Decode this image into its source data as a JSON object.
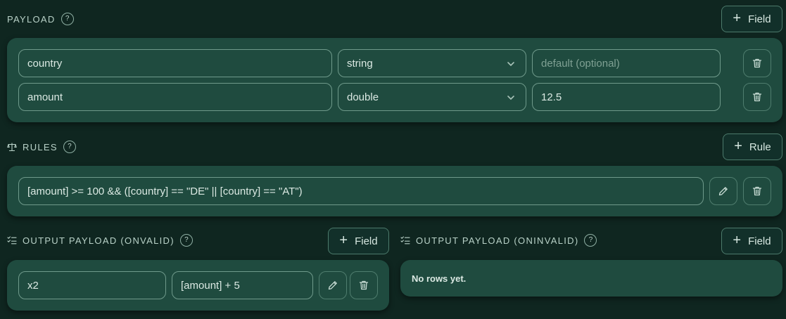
{
  "payload": {
    "title": "PAYLOAD",
    "help": "?",
    "add_label": "Field",
    "rows": [
      {
        "name": "country",
        "type": "string",
        "default_value": "",
        "default_placeholder": "default (optional)"
      },
      {
        "name": "amount",
        "type": "double",
        "default_value": "12.5",
        "default_placeholder": "default (optional)"
      }
    ]
  },
  "rules": {
    "title": "RULES",
    "help": "?",
    "add_label": "Rule",
    "items": [
      {
        "expression": "[amount] >= 100 && ([country] == \"DE\" || [country] == \"AT\")"
      }
    ]
  },
  "output_valid": {
    "title": "OUTPUT PAYLOAD (ONVALID)",
    "help": "?",
    "add_label": "Field",
    "rows": [
      {
        "name": "x2",
        "expression": "[amount] + 5"
      }
    ]
  },
  "output_invalid": {
    "title": "OUTPUT PAYLOAD (ONINVALID)",
    "help": "?",
    "add_label": "Field",
    "empty_text": "No rows yet."
  }
}
